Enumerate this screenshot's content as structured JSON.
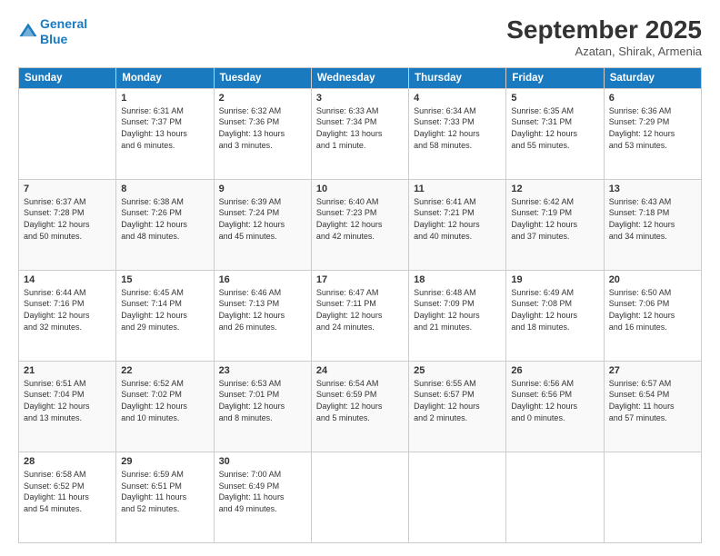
{
  "header": {
    "logo_line1": "General",
    "logo_line2": "Blue",
    "month": "September 2025",
    "location": "Azatan, Shirak, Armenia"
  },
  "weekdays": [
    "Sunday",
    "Monday",
    "Tuesday",
    "Wednesday",
    "Thursday",
    "Friday",
    "Saturday"
  ],
  "weeks": [
    [
      {
        "day": "",
        "info": ""
      },
      {
        "day": "1",
        "info": "Sunrise: 6:31 AM\nSunset: 7:37 PM\nDaylight: 13 hours\nand 6 minutes."
      },
      {
        "day": "2",
        "info": "Sunrise: 6:32 AM\nSunset: 7:36 PM\nDaylight: 13 hours\nand 3 minutes."
      },
      {
        "day": "3",
        "info": "Sunrise: 6:33 AM\nSunset: 7:34 PM\nDaylight: 13 hours\nand 1 minute."
      },
      {
        "day": "4",
        "info": "Sunrise: 6:34 AM\nSunset: 7:33 PM\nDaylight: 12 hours\nand 58 minutes."
      },
      {
        "day": "5",
        "info": "Sunrise: 6:35 AM\nSunset: 7:31 PM\nDaylight: 12 hours\nand 55 minutes."
      },
      {
        "day": "6",
        "info": "Sunrise: 6:36 AM\nSunset: 7:29 PM\nDaylight: 12 hours\nand 53 minutes."
      }
    ],
    [
      {
        "day": "7",
        "info": "Sunrise: 6:37 AM\nSunset: 7:28 PM\nDaylight: 12 hours\nand 50 minutes."
      },
      {
        "day": "8",
        "info": "Sunrise: 6:38 AM\nSunset: 7:26 PM\nDaylight: 12 hours\nand 48 minutes."
      },
      {
        "day": "9",
        "info": "Sunrise: 6:39 AM\nSunset: 7:24 PM\nDaylight: 12 hours\nand 45 minutes."
      },
      {
        "day": "10",
        "info": "Sunrise: 6:40 AM\nSunset: 7:23 PM\nDaylight: 12 hours\nand 42 minutes."
      },
      {
        "day": "11",
        "info": "Sunrise: 6:41 AM\nSunset: 7:21 PM\nDaylight: 12 hours\nand 40 minutes."
      },
      {
        "day": "12",
        "info": "Sunrise: 6:42 AM\nSunset: 7:19 PM\nDaylight: 12 hours\nand 37 minutes."
      },
      {
        "day": "13",
        "info": "Sunrise: 6:43 AM\nSunset: 7:18 PM\nDaylight: 12 hours\nand 34 minutes."
      }
    ],
    [
      {
        "day": "14",
        "info": "Sunrise: 6:44 AM\nSunset: 7:16 PM\nDaylight: 12 hours\nand 32 minutes."
      },
      {
        "day": "15",
        "info": "Sunrise: 6:45 AM\nSunset: 7:14 PM\nDaylight: 12 hours\nand 29 minutes."
      },
      {
        "day": "16",
        "info": "Sunrise: 6:46 AM\nSunset: 7:13 PM\nDaylight: 12 hours\nand 26 minutes."
      },
      {
        "day": "17",
        "info": "Sunrise: 6:47 AM\nSunset: 7:11 PM\nDaylight: 12 hours\nand 24 minutes."
      },
      {
        "day": "18",
        "info": "Sunrise: 6:48 AM\nSunset: 7:09 PM\nDaylight: 12 hours\nand 21 minutes."
      },
      {
        "day": "19",
        "info": "Sunrise: 6:49 AM\nSunset: 7:08 PM\nDaylight: 12 hours\nand 18 minutes."
      },
      {
        "day": "20",
        "info": "Sunrise: 6:50 AM\nSunset: 7:06 PM\nDaylight: 12 hours\nand 16 minutes."
      }
    ],
    [
      {
        "day": "21",
        "info": "Sunrise: 6:51 AM\nSunset: 7:04 PM\nDaylight: 12 hours\nand 13 minutes."
      },
      {
        "day": "22",
        "info": "Sunrise: 6:52 AM\nSunset: 7:02 PM\nDaylight: 12 hours\nand 10 minutes."
      },
      {
        "day": "23",
        "info": "Sunrise: 6:53 AM\nSunset: 7:01 PM\nDaylight: 12 hours\nand 8 minutes."
      },
      {
        "day": "24",
        "info": "Sunrise: 6:54 AM\nSunset: 6:59 PM\nDaylight: 12 hours\nand 5 minutes."
      },
      {
        "day": "25",
        "info": "Sunrise: 6:55 AM\nSunset: 6:57 PM\nDaylight: 12 hours\nand 2 minutes."
      },
      {
        "day": "26",
        "info": "Sunrise: 6:56 AM\nSunset: 6:56 PM\nDaylight: 12 hours\nand 0 minutes."
      },
      {
        "day": "27",
        "info": "Sunrise: 6:57 AM\nSunset: 6:54 PM\nDaylight: 11 hours\nand 57 minutes."
      }
    ],
    [
      {
        "day": "28",
        "info": "Sunrise: 6:58 AM\nSunset: 6:52 PM\nDaylight: 11 hours\nand 54 minutes."
      },
      {
        "day": "29",
        "info": "Sunrise: 6:59 AM\nSunset: 6:51 PM\nDaylight: 11 hours\nand 52 minutes."
      },
      {
        "day": "30",
        "info": "Sunrise: 7:00 AM\nSunset: 6:49 PM\nDaylight: 11 hours\nand 49 minutes."
      },
      {
        "day": "",
        "info": ""
      },
      {
        "day": "",
        "info": ""
      },
      {
        "day": "",
        "info": ""
      },
      {
        "day": "",
        "info": ""
      }
    ]
  ]
}
